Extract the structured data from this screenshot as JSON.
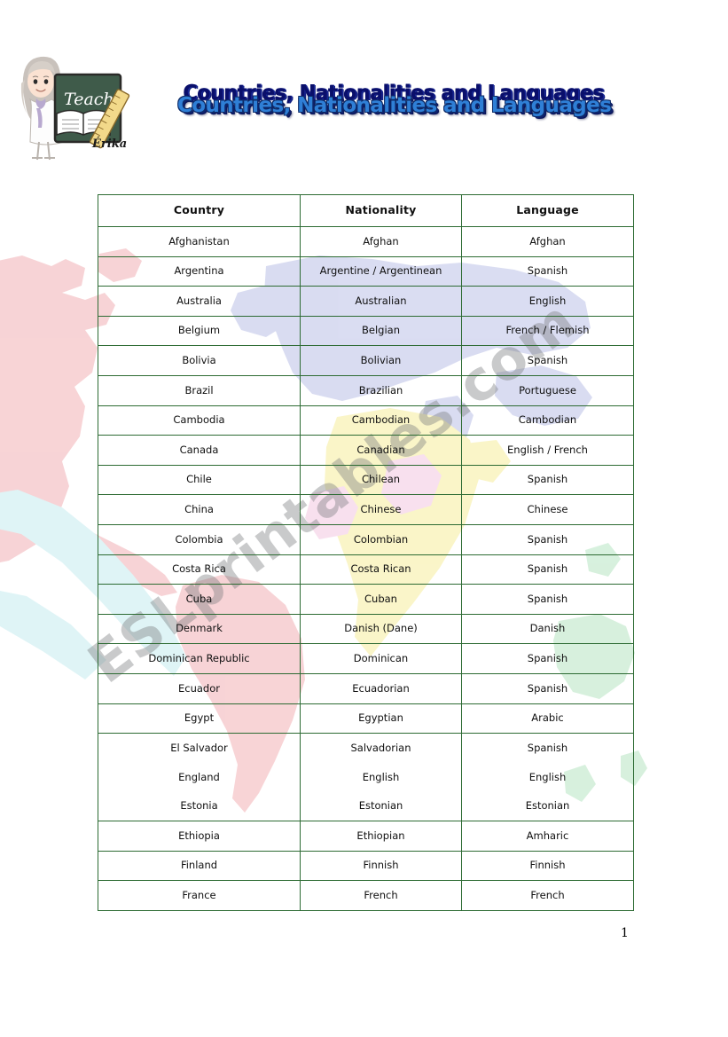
{
  "document": {
    "title": "Countries, Nationalities and Languages",
    "page_number": "1",
    "watermark": "ESLprintables.com"
  },
  "logo": {
    "chalkboard_text": "Teacher",
    "signature_text": "Érika"
  },
  "colors": {
    "table_border": "#2d6b33",
    "title_front": "#2f7fd6",
    "title_back": "#0a0f6b",
    "watermark": "#787a7c",
    "map_americas": "#f6c9cc",
    "map_eurasia": "#ccd0ee",
    "map_africa": "#f9f3b8",
    "map_oceania": "#c8ecd0",
    "map_antarctic": "#d3f0f3",
    "map_pink_accent": "#f7d6e8"
  },
  "table": {
    "headers": [
      "Country",
      "Nationality",
      "Language"
    ],
    "rows": [
      {
        "country": "Afghanistan",
        "nationality": "Afghan",
        "language": "Afghan"
      },
      {
        "country": "Argentina",
        "nationality": "Argentine / Argentinean",
        "language": "Spanish"
      },
      {
        "country": "Australia",
        "nationality": "Australian",
        "language": "English"
      },
      {
        "country": "Belgium",
        "nationality": "Belgian",
        "language": "French / Flemish"
      },
      {
        "country": "Bolivia",
        "nationality": "Bolivian",
        "language": "Spanish"
      },
      {
        "country": "Brazil",
        "nationality": "Brazilian",
        "language": "Portuguese"
      },
      {
        "country": "Cambodia",
        "nationality": "Cambodian",
        "language": "Cambodian"
      },
      {
        "country": "Canada",
        "nationality": "Canadian",
        "language": "English / French"
      },
      {
        "country": "Chile",
        "nationality": "Chilean",
        "language": "Spanish"
      },
      {
        "country": "China",
        "nationality": "Chinese",
        "language": "Chinese"
      },
      {
        "country": "Colombia",
        "nationality": "Colombian",
        "language": "Spanish"
      },
      {
        "country": "Costa Rica",
        "nationality": "Costa Rican",
        "language": "Spanish"
      },
      {
        "country": "Cuba",
        "nationality": "Cuban",
        "language": "Spanish"
      },
      {
        "country": "Denmark",
        "nationality": "Danish (Dane)",
        "language": "Danish"
      },
      {
        "country": "Dominican Republic",
        "nationality": "Dominican",
        "language": "Spanish"
      },
      {
        "country": "Ecuador",
        "nationality": "Ecuadorian",
        "language": "Spanish"
      },
      {
        "country": "Egypt",
        "nationality": "Egyptian",
        "language": "Arabic"
      }
    ],
    "merged_block": {
      "countries": [
        "El Salvador",
        "England",
        "Estonia"
      ],
      "nationalities": [
        "Salvadorian",
        "English",
        "Estonian"
      ],
      "languages": [
        "Spanish",
        "English",
        "Estonian"
      ]
    },
    "rows_after": [
      {
        "country": "Ethiopia",
        "nationality": "Ethiopian",
        "language": "Amharic"
      },
      {
        "country": "Finland",
        "nationality": "Finnish",
        "language": "Finnish"
      },
      {
        "country": "France",
        "nationality": "French",
        "language": "French"
      }
    ]
  }
}
